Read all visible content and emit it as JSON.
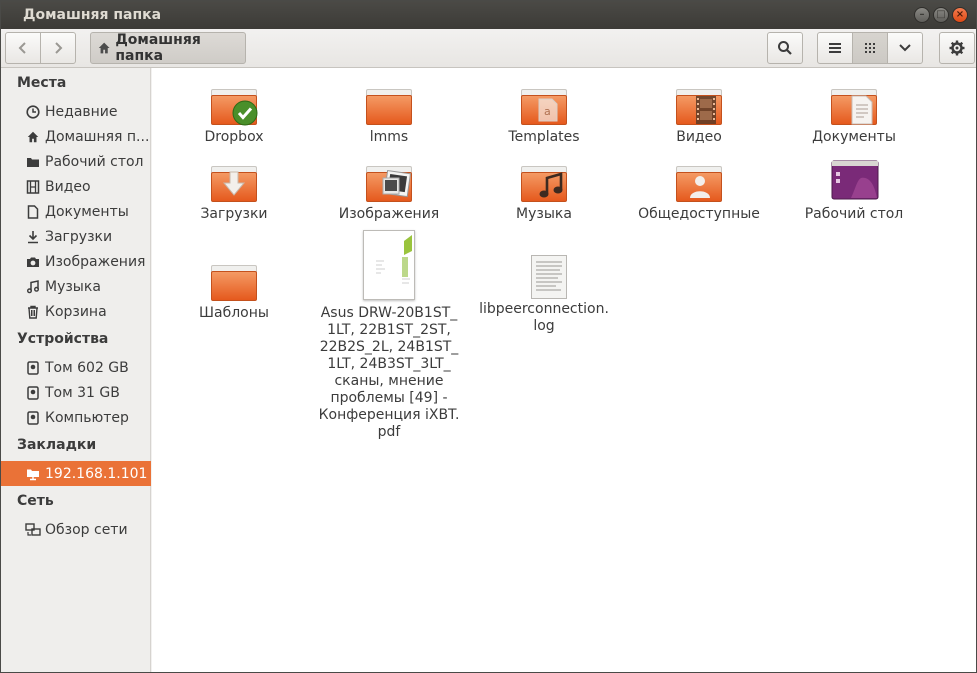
{
  "window": {
    "title": "Домашняя папка"
  },
  "toolbar": {
    "path_label": "Домашняя папка"
  },
  "sidebar": {
    "sections": [
      {
        "title": "Места",
        "items": [
          {
            "label": "Недавние",
            "icon": "clock-icon"
          },
          {
            "label": "Домашняя п...",
            "icon": "home-icon"
          },
          {
            "label": "Рабочий стол",
            "icon": "folder-icon"
          },
          {
            "label": "Видео",
            "icon": "film-icon"
          },
          {
            "label": "Документы",
            "icon": "document-icon"
          },
          {
            "label": "Загрузки",
            "icon": "download-icon"
          },
          {
            "label": "Изображения",
            "icon": "camera-icon"
          },
          {
            "label": "Музыка",
            "icon": "music-icon"
          },
          {
            "label": "Корзина",
            "icon": "trash-icon"
          }
        ]
      },
      {
        "title": "Устройства",
        "items": [
          {
            "label": "Том 602 GB",
            "icon": "drive-icon"
          },
          {
            "label": "Том 31 GB",
            "icon": "drive-icon"
          },
          {
            "label": "Компьютер",
            "icon": "drive-icon"
          }
        ]
      },
      {
        "title": "Закладки",
        "items": [
          {
            "label": "192.168.1.101",
            "icon": "network-folder-icon",
            "active": true
          }
        ]
      },
      {
        "title": "Сеть",
        "items": [
          {
            "label": "Обзор сети",
            "icon": "network-icon"
          }
        ]
      }
    ]
  },
  "files": [
    {
      "name": "Dropbox",
      "icon": "folder-dropbox-icon"
    },
    {
      "name": "lmms",
      "icon": "folder-icon"
    },
    {
      "name": "Templates",
      "icon": "folder-templates-icon"
    },
    {
      "name": "Видео",
      "icon": "folder-video-icon"
    },
    {
      "name": "Документы",
      "icon": "folder-documents-icon"
    },
    {
      "name": "Загрузки",
      "icon": "folder-downloads-icon"
    },
    {
      "name": "Изображения",
      "icon": "folder-pictures-icon"
    },
    {
      "name": "Музыка",
      "icon": "folder-music-icon"
    },
    {
      "name": "Общедоступные",
      "icon": "folder-public-icon"
    },
    {
      "name": "Рабочий стол",
      "icon": "desktop-folder-icon"
    },
    {
      "name": "Шаблоны",
      "icon": "folder-icon"
    },
    {
      "name": "Asus DRW-20B1ST_\n1LT, 22B1ST_2ST,\n22B2S_2L, 24B1ST_\n1LT, 24B3ST_3LT_\nсканы, мнение\nпроблемы [49] -\nКонференция iXBT.\npdf",
      "icon": "pdf-thumbnail-icon"
    },
    {
      "name": "libpeerconnection.\nlog",
      "icon": "text-file-icon"
    }
  ],
  "colors": {
    "accent": "#ea7237",
    "folder": "#e96b2f",
    "titlebar": "#3c3b37"
  }
}
